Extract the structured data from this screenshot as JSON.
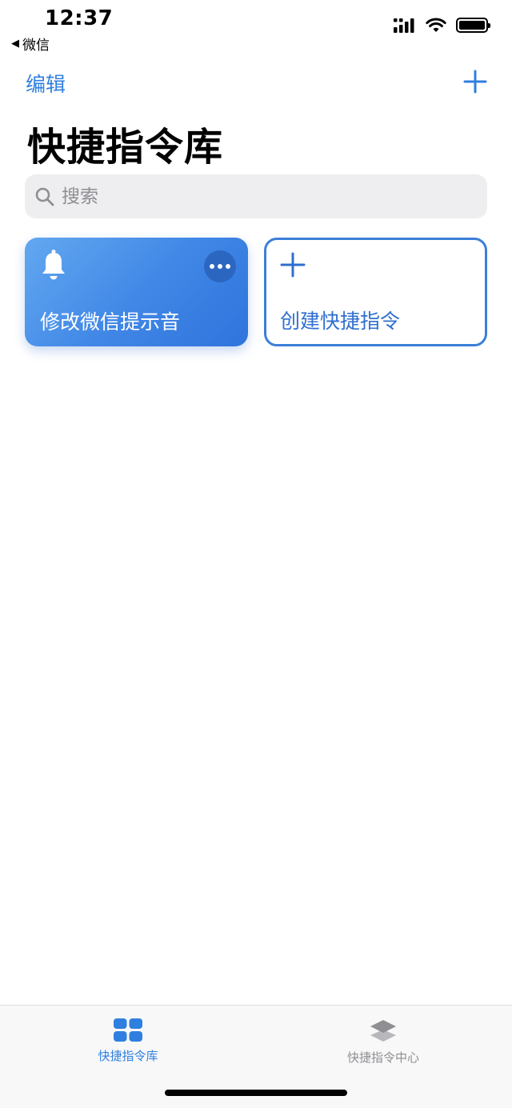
{
  "status_bar": {
    "time": "12:37",
    "back_app": "微信",
    "icons": [
      "signal-icon",
      "wifi-icon",
      "battery-icon"
    ]
  },
  "nav": {
    "edit_label": "编辑",
    "add_icon": "plus-icon"
  },
  "page": {
    "title": "快捷指令库"
  },
  "search": {
    "placeholder": "搜索"
  },
  "shortcuts": [
    {
      "title": "修改微信提示音",
      "icon": "bell-icon",
      "color": "#3f86e6"
    },
    {
      "title": "创建快捷指令",
      "icon": "plus-icon"
    }
  ],
  "tab_bar": {
    "tabs": [
      {
        "label": "快捷指令库",
        "icon": "grid-icon",
        "active": true
      },
      {
        "label": "快捷指令中心",
        "icon": "layers-icon",
        "active": false
      }
    ]
  },
  "colors": {
    "accent": "#2f7fe0",
    "card_blue": "#3f86e6",
    "search_bg": "#eeeef0"
  }
}
